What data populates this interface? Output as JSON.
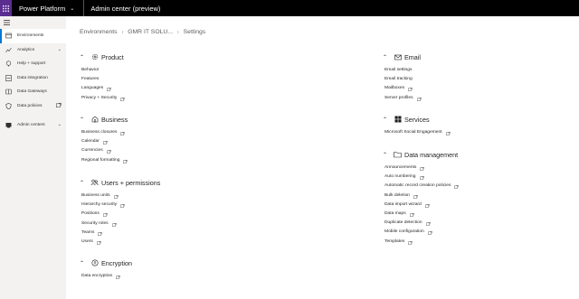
{
  "topbar": {
    "waffle_icon": "waffle-icon",
    "product_name": "Power Platform",
    "app_name": "Admin center (preview)"
  },
  "sidebar": {
    "menu_icon": "hamburger-icon",
    "items": [
      {
        "label": "Environments",
        "icon": "environment-icon",
        "active": true
      },
      {
        "label": "Analytics",
        "icon": "chart-icon",
        "trailing": "chevron-down-icon"
      },
      {
        "label": "Help + support",
        "icon": "help-icon"
      },
      {
        "label": "Data integration",
        "icon": "data-integration-icon"
      },
      {
        "label": "Data Gateways",
        "icon": "gateway-icon"
      },
      {
        "label": "Data policies",
        "icon": "shield-icon",
        "trailing": "external-link-icon"
      },
      {
        "label": "Admin centers",
        "icon": "admin-centers-icon",
        "trailing": "chevron-down-icon"
      }
    ]
  },
  "breadcrumb": {
    "items": [
      "Environments",
      "GMR IT SOLU...",
      "Settings"
    ]
  },
  "sections": {
    "product": {
      "title": "Product",
      "links": [
        {
          "label": "Behavior"
        },
        {
          "label": "Features"
        },
        {
          "label": "Languages",
          "external": true
        },
        {
          "label": "Privacy + Security",
          "external": true
        }
      ]
    },
    "business": {
      "title": "Business",
      "links": [
        {
          "label": "Business closures",
          "external": true
        },
        {
          "label": "Calendar",
          "external": true
        },
        {
          "label": "Currencies",
          "external": true
        },
        {
          "label": "Regional formatting",
          "external": true
        }
      ]
    },
    "users": {
      "title": "Users + permissions",
      "links": [
        {
          "label": "Business units",
          "external": true
        },
        {
          "label": "Hierarchy security",
          "external": true
        },
        {
          "label": "Positions",
          "external": true
        },
        {
          "label": "Security roles",
          "external": true
        },
        {
          "label": "Teams",
          "external": true
        },
        {
          "label": "Users",
          "external": true
        }
      ]
    },
    "encryption": {
      "title": "Encryption",
      "links": [
        {
          "label": "Data encryption",
          "external": true
        }
      ]
    },
    "email": {
      "title": "Email",
      "links": [
        {
          "label": "Email settings"
        },
        {
          "label": "Email tracking"
        },
        {
          "label": "Mailboxes",
          "external": true
        },
        {
          "label": "Server profiles",
          "external": true
        }
      ]
    },
    "services": {
      "title": "Services",
      "links": [
        {
          "label": "Microsoft Social Engagement",
          "external": true
        }
      ]
    },
    "data_management": {
      "title": "Data management",
      "links": [
        {
          "label": "Announcements",
          "external": true
        },
        {
          "label": "Auto numbering",
          "external": true
        },
        {
          "label": "Automatic record creation policies",
          "external": true
        },
        {
          "label": "Bulk deletion",
          "external": true
        },
        {
          "label": "Data import wizard",
          "external": true
        },
        {
          "label": "Data maps",
          "external": true
        },
        {
          "label": "Duplicate detection",
          "external": true
        },
        {
          "label": "Mobile configuration",
          "external": true
        },
        {
          "label": "Templates",
          "external": true
        }
      ]
    }
  },
  "colors": {
    "topbar": "#000000",
    "waffle": "#5c2d91",
    "accent": "#0078d4",
    "sidebar": "#f3f2f1"
  }
}
